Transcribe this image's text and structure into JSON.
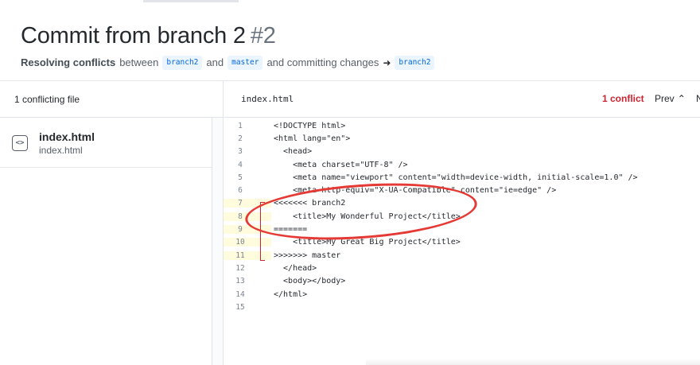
{
  "header": {
    "title": "Commit from branch 2",
    "number": "#2",
    "subtitle_strong": "Resolving conflicts",
    "subtitle_between": "between",
    "branch_from": "branch2",
    "subtitle_and": "and",
    "branch_to": "master",
    "subtitle_action": "and committing changes",
    "arrow": "➜",
    "target_branch": "branch2"
  },
  "files_panel": {
    "heading": "1 conflicting file",
    "files": [
      {
        "name": "index.html",
        "path": "index.html",
        "icon": "code-file-icon",
        "icon_glyph": "<>"
      }
    ]
  },
  "editor": {
    "filename": "index.html",
    "conflict_label": "1 conflict",
    "prev_label": "Prev",
    "prev_glyph": "⌃",
    "next_label": "N",
    "lines": [
      {
        "n": "1",
        "text": "<!DOCTYPE html>",
        "conflict": false
      },
      {
        "n": "2",
        "text": "<html lang=\"en\">",
        "conflict": false
      },
      {
        "n": "3",
        "text": "  <head>",
        "conflict": false
      },
      {
        "n": "4",
        "text": "    <meta charset=\"UTF-8\" />",
        "conflict": false
      },
      {
        "n": "5",
        "text": "    <meta name=\"viewport\" content=\"width=device-width, initial-scale=1.0\" />",
        "conflict": false
      },
      {
        "n": "6",
        "text": "    <meta http-equiv=\"X-UA-Compatible\" content=\"ie=edge\" />",
        "conflict": false
      },
      {
        "n": "7",
        "text": "<<<<<<< branch2",
        "conflict": true
      },
      {
        "n": "8",
        "text": "    <title>My Wonderful Project</title>",
        "conflict": true
      },
      {
        "n": "9",
        "text": "=======",
        "conflict": true
      },
      {
        "n": "10",
        "text": "    <title>My Great Big Project</title>",
        "conflict": true
      },
      {
        "n": "11",
        "text": ">>>>>>> master",
        "conflict": true
      },
      {
        "n": "12",
        "text": "  </head>",
        "conflict": false
      },
      {
        "n": "13",
        "text": "  <body></body>",
        "conflict": false
      },
      {
        "n": "14",
        "text": "</html>",
        "conflict": false
      },
      {
        "n": "15",
        "text": "",
        "conflict": false
      }
    ]
  },
  "colors": {
    "conflict_red": "#cb2431",
    "annotation_red": "#e53935",
    "conflict_gutter": "#fffbdd",
    "branch_blue": "#0366d6"
  }
}
